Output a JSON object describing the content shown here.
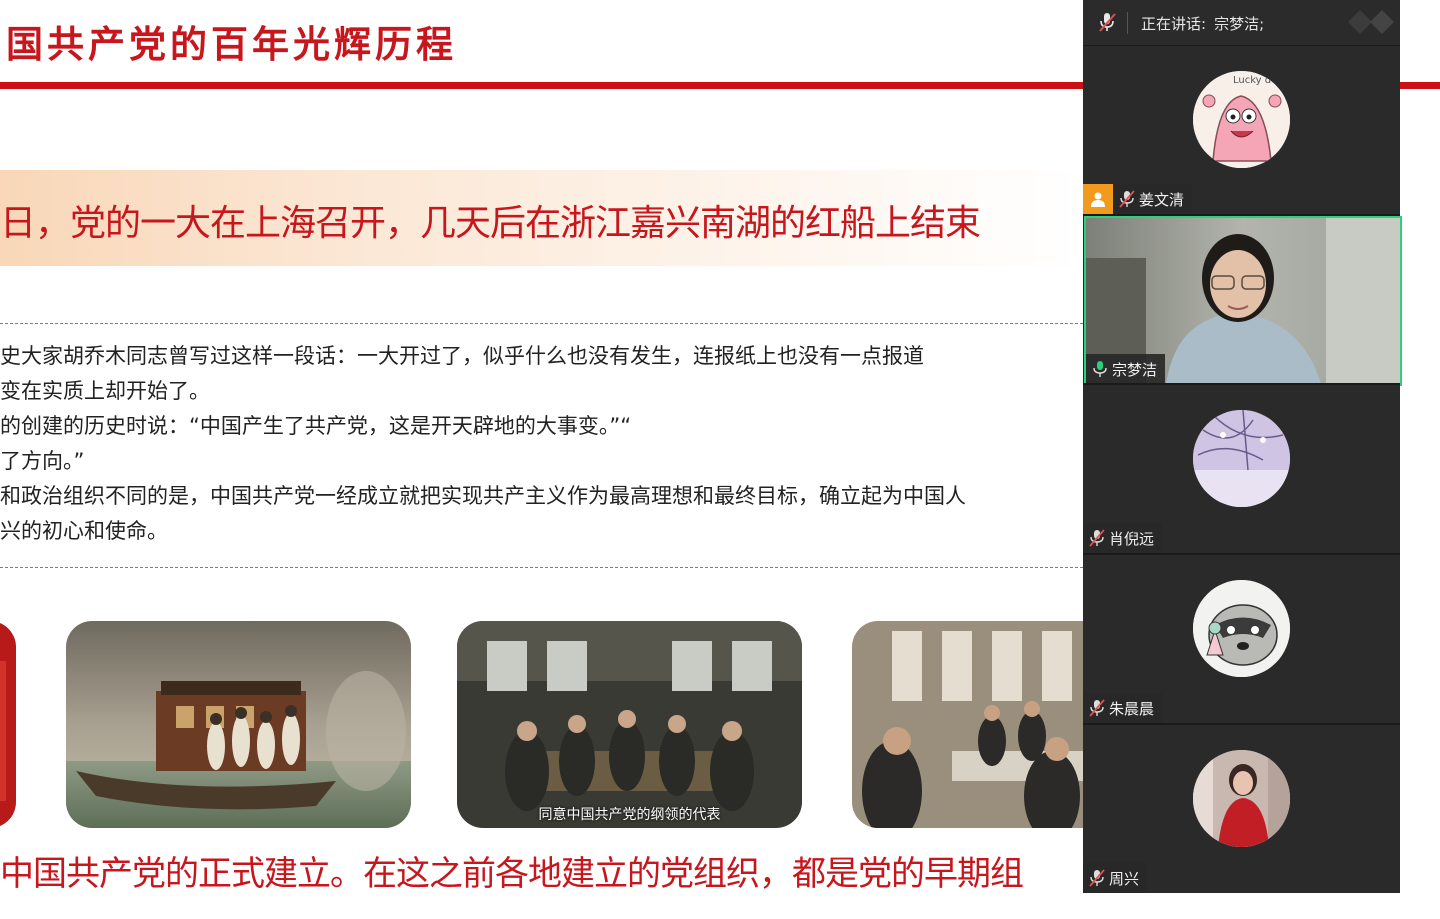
{
  "slide": {
    "title": "国共产党的百年光辉历程",
    "banner": "日，党的一大在上海召开，几天后在浙江嘉兴南湖的红船上结束",
    "paragraphs": [
      "史大家胡乔木同志曾写过这样一段话：一大开过了，似乎什么也没有发生，连报纸上也没有一点报道",
      "变在实质上却开始了。",
      "的创建的历史时说：“中国产生了共产党，这是开天辟地的大事变。”“",
      "了方向。”",
      "和政治组织不同的是，中国共产党一经成立就把实现共产主义作为最高理想和最终目标，确立起为中国人",
      "兴的初心和使命。"
    ],
    "photo_caption": "同意中国共产党的纲领的代表",
    "bottom_text": "中国共产党的正式建立。在这之前各地建立的党组织，都是党的早期组"
  },
  "meeting": {
    "header_label": "正在讲话:",
    "current_speaker": "宗梦洁;",
    "participants": [
      {
        "name": "姜文清",
        "video": false,
        "muted": true,
        "host": true
      },
      {
        "name": "宗梦洁",
        "video": true,
        "muted": false,
        "speaking": true
      },
      {
        "name": "肖倪远",
        "video": false,
        "muted": true
      },
      {
        "name": "朱晨晨",
        "video": false,
        "muted": true
      },
      {
        "name": "周兴",
        "video": false,
        "muted": true
      }
    ],
    "avatar_text": "Lucky do",
    "colors": {
      "panel_bg": "#262626",
      "speaking_border": "#2bd07a",
      "host_badge": "#f29a1d",
      "muted_icon": "#e05050"
    }
  }
}
